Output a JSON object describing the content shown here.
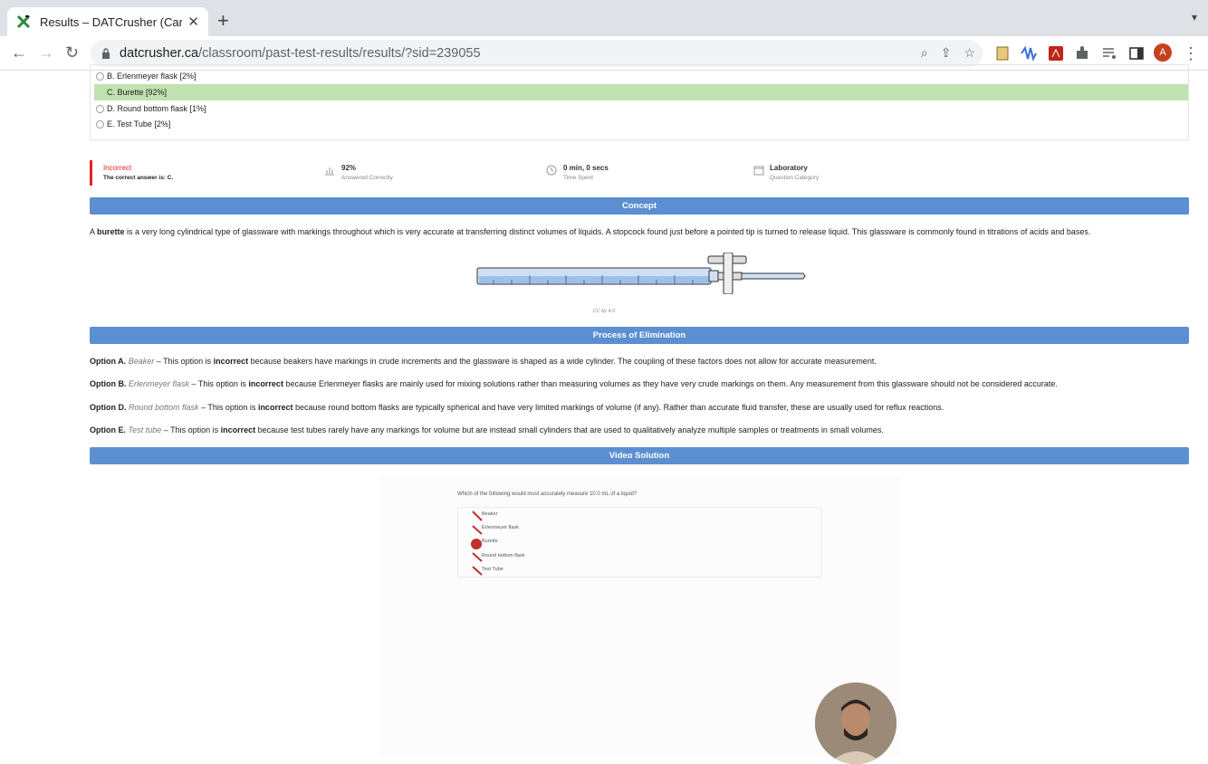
{
  "browser": {
    "tab_title": "Results – DATCrusher (Canadia",
    "url_domain": "datcrusher.ca",
    "url_path": "/classroom/past-test-results/results/?sid=239055",
    "avatar_letter": "A",
    "accent_color": "#c5421f"
  },
  "options": [
    {
      "label": "B. Erlenmeyer flask [2%]",
      "correct": false
    },
    {
      "label": "C. Burette [92%]",
      "correct": true
    },
    {
      "label": "D. Round bottom flask [1%]",
      "correct": false
    },
    {
      "label": "E. Test Tube [2%]",
      "correct": false
    }
  ],
  "stats": {
    "result": "Incorrect",
    "correct_answer": "The correct answer is: C.",
    "percent": "92%",
    "percent_label": "Answered Correctly",
    "time": "0 min, 0 secs",
    "time_label": "Time Spent",
    "category": "Laboratory",
    "category_label": "Question Category"
  },
  "concept": {
    "header": "Concept",
    "text_pre": "A ",
    "text_bold": "burette",
    "text_post": " is a very long cylindrical type of glassware with markings throughout which is very accurate at transferring distinct volumes of liquids. A stopcock found just before a pointed tip is turned to release liquid. This glassware is commonly found in titrations of acids and bases.",
    "image_credit": "CC by 4.0"
  },
  "elimination": {
    "header": "Process of Elimination",
    "items": [
      {
        "option": "Option A.",
        "name": "Beaker",
        "pre": " – This option is ",
        "bold": "incorrect",
        "post": " because beakers have markings in crude increments and the glassware is shaped as a wide cylinder. The coupling of these factors does not allow for accurate measurement."
      },
      {
        "option": "Option B.",
        "name": "Erlenmeyer flask",
        "pre": " – This option is ",
        "bold": "incorrect",
        "post": " because Erlenmeyer flasks are mainly used for mixing solutions rather than measuring volumes as they have very crude markings on them. Any measurement from this glassware should not be considered accurate."
      },
      {
        "option": "Option D.",
        "name": "Round bottom flask",
        "pre": " – This option is ",
        "bold": "incorrect",
        "post": " because round bottom flasks are typically spherical and have very limited markings of volume (if any). Rather than accurate fluid transfer, these are usually used for reflux reactions."
      },
      {
        "option": "Option E.",
        "name": "Test tube",
        "pre": " – This option is ",
        "bold": "incorrect",
        "post": " because test tubes rarely have any markings for volume but are instead small cylinders that are used to qualitatively analyze multiple samples or treatments in small volumes."
      }
    ]
  },
  "video": {
    "header": "Video Solution",
    "question": "Which of the following would most accurately measure 10.0 mL of a liquid?",
    "options": [
      "Beaker",
      "Erlenmeyer flask",
      "Burette",
      "Round bottom flask",
      "Test Tube"
    ]
  }
}
